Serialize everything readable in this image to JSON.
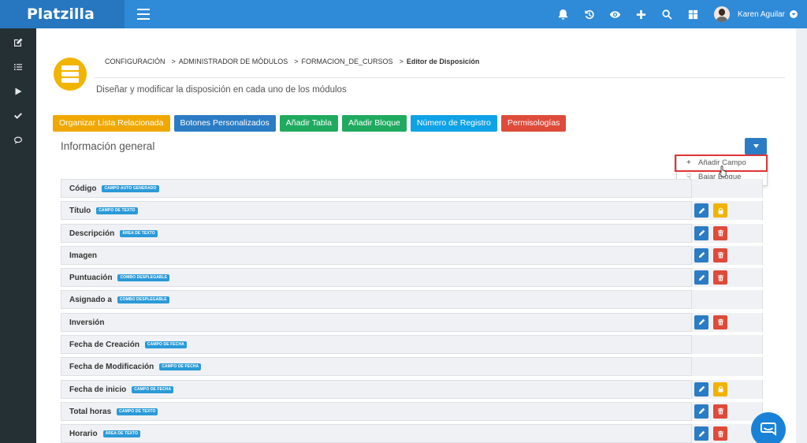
{
  "app": {
    "name": "Platzilla"
  },
  "user": {
    "name": "Karen Aguilar"
  },
  "topbar_icons": [
    "bell-icon",
    "history-icon",
    "eye-icon",
    "plus-icon",
    "search-icon",
    "grid-icon"
  ],
  "sidebar": {
    "items": [
      {
        "icon": "edit-icon"
      },
      {
        "icon": "list-icon"
      },
      {
        "icon": "play-icon"
      },
      {
        "icon": "check-icon"
      },
      {
        "icon": "chat-icon"
      }
    ]
  },
  "breadcrumb": {
    "items": [
      "CONFIGURACIÓN",
      "ADMINISTRADOR DE MÓDULOS",
      "FORMACION_DE_CURSOS"
    ],
    "separator": ">",
    "current": "Editor de Disposición"
  },
  "page": {
    "subtitle": "Diseñar y modificar la disposición en cada uno de los módulos"
  },
  "buttons": {
    "related_list": "Organizar Lista Relacionada",
    "custom_buttons": "Botones Personalizados",
    "add_table": "Añadir Tabla",
    "add_block": "Añadir Bloque",
    "record_number": "Número de Registro",
    "permissions": "Permisologías"
  },
  "panel": {
    "title": "Información general",
    "dropdown": {
      "add_field": "Añadir Campo",
      "move_block": "Bajar Bloque"
    }
  },
  "fields": [
    {
      "label": "Código",
      "tag": "CAMPO AUTO GENERADO",
      "actions": "none"
    },
    {
      "label": "Título",
      "tag": "CAMPO DE TEXTO",
      "actions": "edit-lock"
    },
    {
      "label": "Descripción",
      "tag": "ÁREA DE TEXTO",
      "actions": "edit-delete"
    },
    {
      "label": "Imagen",
      "tag": "",
      "actions": "edit-delete"
    },
    {
      "label": "Puntuación",
      "tag": "COMBO DESPLEGABLE",
      "actions": "edit-delete"
    },
    {
      "label": "Asignado a",
      "tag": "COMBO DESPLEGABLE",
      "actions": "none"
    },
    {
      "label": "Inversión",
      "tag": "",
      "actions": "edit-delete"
    },
    {
      "label": "Fecha de Creación",
      "tag": "CAMPO DE FECHA",
      "actions": "none"
    },
    {
      "label": "Fecha de Modificación",
      "tag": "CAMPO DE FECHA",
      "actions": "none"
    },
    {
      "label": "Fecha de inicio",
      "tag": "CAMPO DE FECHA",
      "actions": "edit-lock"
    },
    {
      "label": "Total horas",
      "tag": "CAMPO DE TEXTO",
      "actions": "edit-delete"
    },
    {
      "label": "Horario",
      "tag": "ÁREA DE TEXTO",
      "actions": "edit-delete"
    }
  ],
  "colors": {
    "topbar": "#2f8ad8",
    "logo_bg": "#2677c0",
    "sidebar": "#253035",
    "accent_yellow": "#f0a800",
    "accent_blue": "#2b7cc4",
    "accent_green": "#1faa60",
    "accent_cyan": "#0fa2e6",
    "accent_red": "#de4b3a",
    "highlight_red": "#e03535"
  }
}
